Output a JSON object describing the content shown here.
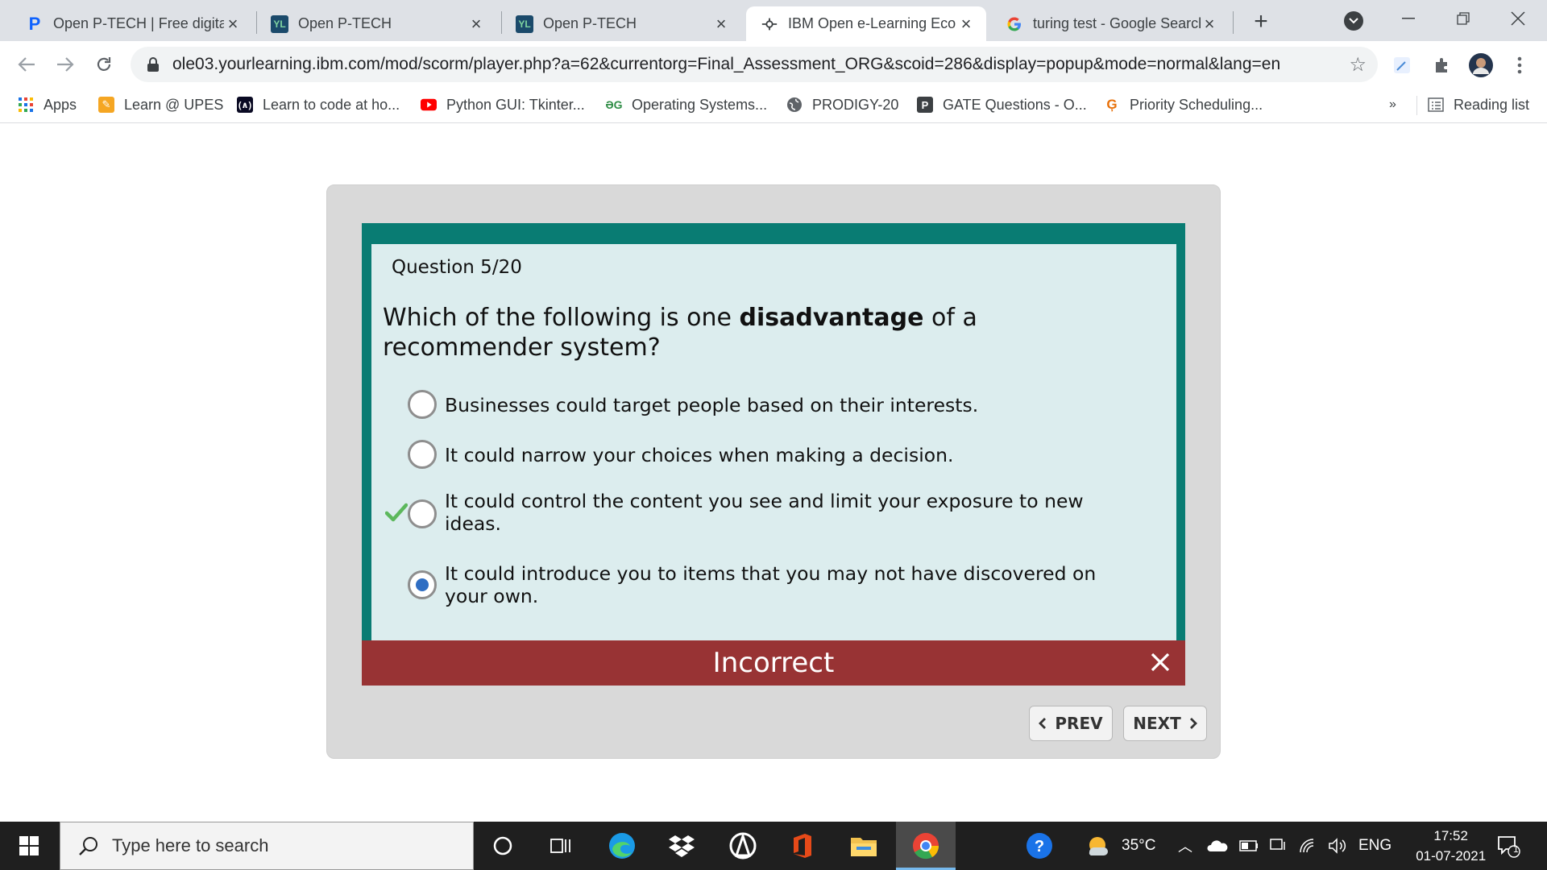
{
  "browser": {
    "tabs": [
      {
        "title": "Open P-TECH | Free digital",
        "favicon": "P",
        "favicon_color": "#0f62fe",
        "active": false
      },
      {
        "title": "Open P-TECH",
        "favicon": "YL",
        "favicon_color": "#1b4a6b",
        "active": false
      },
      {
        "title": "Open P-TECH",
        "favicon": "YL",
        "favicon_color": "#1b4a6b",
        "active": false
      },
      {
        "title": "IBM Open e-Learning Eco",
        "favicon": "ibm-logo-icon",
        "active": true
      },
      {
        "title": "turing test - Google Search",
        "favicon": "G",
        "active": false
      }
    ],
    "url": "ole03.yourlearning.ibm.com/mod/scorm/player.php?a=62&currentorg=Final_Assessment_ORG&scoid=286&display=popup&mode=normal&lang=en",
    "bookmarks": [
      {
        "label": "Apps",
        "icon": "apps-grid-icon"
      },
      {
        "label": "Learn @ UPES",
        "icon": "upes-icon"
      },
      {
        "label": "Learn to code at ho...",
        "icon": "code-icon"
      },
      {
        "label": "Python GUI: Tkinter...",
        "icon": "youtube-icon"
      },
      {
        "label": "Operating Systems...",
        "icon": "gfg-icon"
      },
      {
        "label": "PRODIGY-20",
        "icon": "globe-icon"
      },
      {
        "label": "GATE Questions - O...",
        "icon": "p-icon"
      },
      {
        "label": "Priority Scheduling...",
        "icon": "g-icon"
      }
    ],
    "more_bookmarks": "»",
    "reading_list": "Reading list"
  },
  "quiz": {
    "question_number": "Question 5/20",
    "question_pre": "Which of the following is one ",
    "question_bold": "disadvantage",
    "question_post": " of a recommender system?",
    "options": [
      {
        "label": "Businesses could target people based on their interests.",
        "selected": false,
        "correct": false
      },
      {
        "label": "It could narrow your choices when making a decision.",
        "selected": false,
        "correct": false
      },
      {
        "label": "It could control the content you see and limit your exposure to new ideas.",
        "selected": false,
        "correct": true
      },
      {
        "label": "It could introduce you to items that you may not have discovered on your own.",
        "selected": true,
        "correct": false
      }
    ],
    "feedback": "Incorrect",
    "prev_label": "PREV",
    "next_label": "NEXT",
    "colors": {
      "frame": "#097c73",
      "panel": "#dcedee",
      "incorrect": "#983334",
      "selected_dot": "#2f6ec3",
      "check": "#5cb85c"
    }
  },
  "taskbar": {
    "search_placeholder": "Type here to search",
    "temperature": "35°C",
    "language": "ENG",
    "time": "17:52",
    "date": "01-07-2021",
    "notifications": "1"
  }
}
